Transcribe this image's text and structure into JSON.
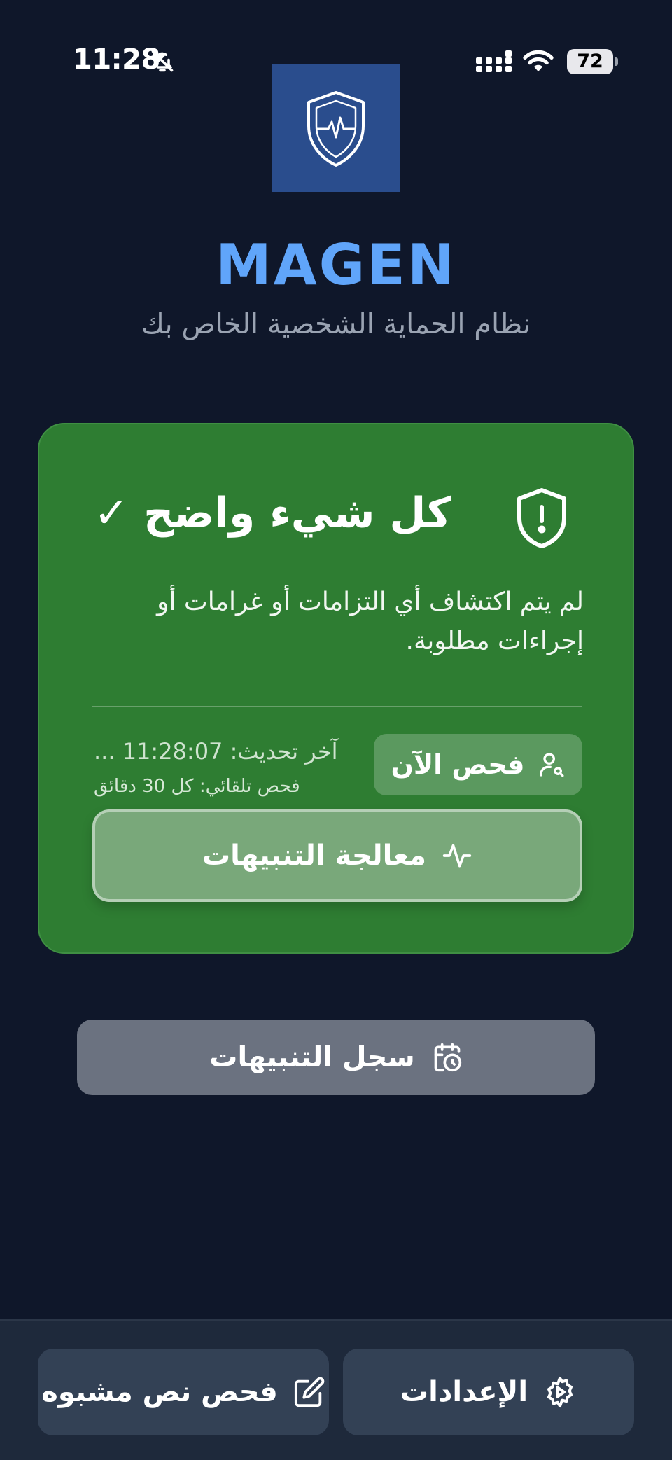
{
  "status_bar": {
    "time": "11:28",
    "battery": "72",
    "icons": [
      "bell-slash-icon",
      "cellular-signal-icon",
      "wifi-icon",
      "battery-icon"
    ]
  },
  "header": {
    "logo_icon": "shield-heartbeat-icon",
    "title": "MAGEN",
    "subtitle": "نظام الحماية الشخصية الخاص بك",
    "title_color": "#60a5fa"
  },
  "status_card": {
    "icon": "shield-exclamation-icon",
    "title": "كل شيء واضح ✓",
    "description": "لم يتم اكتشاف أي التزامات أو غرامات أو إجراءات مطلوبة.",
    "last_update": "آخر تحديث: 11:28:07 ...",
    "auto_scan": "فحص تلقائي: كل 30 دقائق",
    "scan_now_label": "فحص الآن",
    "scan_now_icon": "user-search-icon",
    "process_alerts_label": "معالجة التنبيهات",
    "process_alerts_icon": "activity-icon",
    "color": "#2e7d32"
  },
  "alert_history": {
    "label": "سجل التنبيهات",
    "icon": "calendar-clock-icon"
  },
  "bottom_nav": {
    "suspicious_text_label": "فحص نص مشبوه",
    "suspicious_text_icon": "edit-square-icon",
    "settings_label": "الإعدادات",
    "settings_icon": "gear-icon"
  },
  "colors": {
    "background": "#0f172a",
    "card_green": "#2e7d32",
    "accent_blue": "#60a5fa",
    "history_button": "#6b7280",
    "bottom_buttons": "#334155"
  }
}
